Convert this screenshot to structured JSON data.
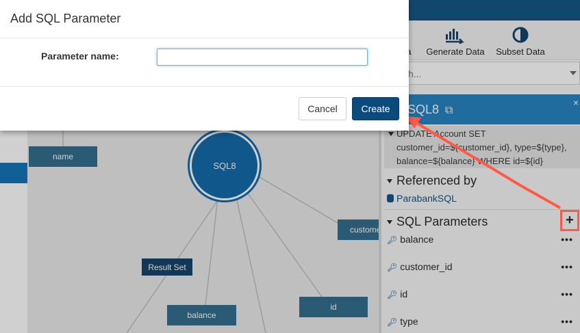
{
  "dialog": {
    "title": "Add SQL Parameter",
    "field_label": "Parameter name:",
    "field_value": "",
    "field_placeholder": "",
    "cancel_label": "Cancel",
    "create_label": "Create"
  },
  "toolbar": {
    "items": [
      {
        "label": "ta",
        "icon": "data-icon"
      },
      {
        "label": "Generate Data",
        "icon": "generate-data-icon"
      },
      {
        "label": "Subset Data",
        "icon": "subset-data-icon"
      }
    ]
  },
  "search": {
    "placeholder": "h..."
  },
  "canvas": {
    "center_node": "SQL8",
    "nodes": {
      "name": "name",
      "customer": "custome",
      "result_set": "Result Set",
      "balance": "balance",
      "id": "id"
    }
  },
  "sidebar": {
    "title": "SQL8",
    "close": "×",
    "description": "UPDATE Account SET customer_id=${customer_id}, type=${type}, balance=${balance} WHERE id=${id}",
    "referenced_by_label": "Referenced by",
    "referenced_item": "ParabankSQL",
    "parameters_label": "SQL Parameters",
    "add_label": "+",
    "parameters": [
      {
        "name": "balance"
      },
      {
        "name": "customer_id"
      },
      {
        "name": "id"
      },
      {
        "name": "type"
      }
    ],
    "menu_label": "•••"
  },
  "colors": {
    "brand": "#0b4f80",
    "primary_button": "#0d4a7c",
    "accent": "#1e7fc0",
    "annotation": "#ff5a46"
  }
}
